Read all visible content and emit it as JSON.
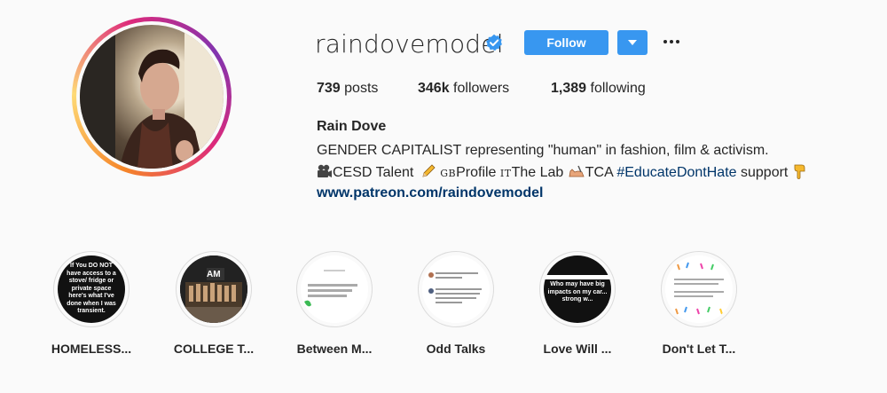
{
  "profile": {
    "username": "raindovemodel",
    "verified": true,
    "follow_label": "Follow",
    "stats": {
      "posts_count": "739",
      "posts_label": "posts",
      "followers_count": "346k",
      "followers_label": "followers",
      "following_count": "1,389",
      "following_label": "following"
    },
    "bio": {
      "name": "Rain Dove",
      "line1": "GENDER CAPITALIST representing \"human\" in fashion, film & activism.",
      "cesd": "CESD Talent",
      "gb_prefix": "GB",
      "gb_text": "Profile",
      "it_prefix": "IT",
      "it_text": "The Lab",
      "tca": "TCA",
      "hashtag": "#EducateDontHate",
      "support": "support",
      "link": "www.patreon.com/raindovemodel"
    }
  },
  "icons": {
    "verified": "verified-badge-icon",
    "dropdown": "caret-down-icon",
    "more": "ellipsis-icon",
    "film": "film-camera-icon",
    "pencil": "pencil-icon",
    "writing": "writing-hand-icon",
    "pointing": "pointing-down-icon"
  },
  "colors": {
    "accent": "#3897f0",
    "link": "#003569",
    "text": "#262626",
    "background": "#fafafa",
    "verified": "#3897f0"
  },
  "highlights": [
    {
      "label": "HOMELESS...",
      "preview": "If You DO NOT have access to a stove/ fridge or private space here's what I've done when I was transient."
    },
    {
      "label": "COLLEGE T...",
      "preview": "AM"
    },
    {
      "label": "Between M..."
    },
    {
      "label": "Odd Talks"
    },
    {
      "label": "Love Will ...",
      "preview": "Who may have big impacts on my car... strong w..."
    },
    {
      "label": "Don't Let T..."
    }
  ]
}
